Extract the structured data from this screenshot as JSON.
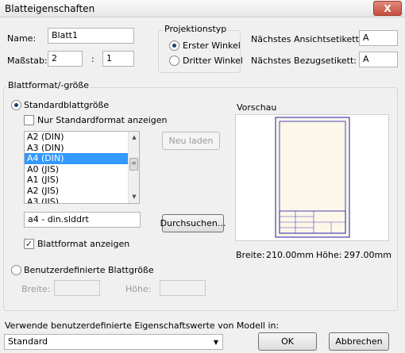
{
  "window": {
    "title": "Blatteigenschaften",
    "close_glyph": "X"
  },
  "name": {
    "label": "Name:",
    "value": "Blatt1"
  },
  "scale": {
    "label": "Maßstab:",
    "numerator": "2",
    "separator": ":",
    "denominator": "1"
  },
  "projection": {
    "legend": "Projektionstyp",
    "first_angle": "Erster Winkel",
    "third_angle": "Dritter Winkel",
    "selected": "first_angle"
  },
  "labels": {
    "next_view_label": "Nächstes Ansichtsetikett:",
    "next_view_value": "A",
    "next_datum_label": "Nächstes Bezugsetikett:",
    "next_datum_value": "A"
  },
  "sheet_format": {
    "legend": "Blattformat/-größe",
    "standard_option": "Standardblattgröße",
    "only_standard": "Nur Standardformat anzeigen",
    "only_standard_checked": false,
    "sizes": [
      "A2 (DIN)",
      "A3 (DIN)",
      "A4 (DIN)",
      "A0 (JIS)",
      "A1 (JIS)",
      "A2 (JIS)",
      "A3 (JIS)"
    ],
    "selected_size": "A4 (DIN)",
    "reload_button": "Neu laden",
    "file_value": "a4 - din.slddrt",
    "browse_button": "Durchsuchen...",
    "show_format": "Blattformat anzeigen",
    "show_format_checked": true,
    "custom_option": "Benutzerdefinierte Blattgröße",
    "width_label": "Breite:",
    "height_label": "Höhe:"
  },
  "preview": {
    "legend": "Vorschau",
    "width_label": "Breite:",
    "width_value": "210.00mm",
    "height_label": "Höhe:",
    "height_value": "297.00mm"
  },
  "footer": {
    "custom_props_label": "Verwende benutzerdefinierte Eigenschaftswerte von Modell in:",
    "combo_value": "Standard",
    "ok_button": "OK",
    "cancel_button": "Abbrechen"
  },
  "icons": {
    "radio": "radio-icon",
    "check": "checkmark-icon",
    "dropdown": "chevron-down-icon"
  }
}
